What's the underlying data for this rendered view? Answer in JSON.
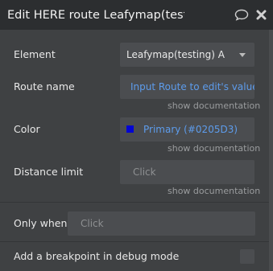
{
  "window": {
    "title": "Edit HERE route Leafymap(testir",
    "icons": {
      "comment": "comment-icon",
      "close": "close-icon"
    }
  },
  "fields": {
    "element": {
      "label": "Element",
      "value": "Leafymap(testing) A"
    },
    "route_name": {
      "label": "Route name",
      "value": "Input Route to edit's value",
      "doc": "show documentation"
    },
    "color": {
      "label": "Color",
      "value": "Primary (#0205D3)",
      "swatch": "#0205D3",
      "doc": "show documentation"
    },
    "distance_limit": {
      "label": "Distance limit",
      "placeholder": "Click",
      "doc": "show documentation"
    },
    "only_when": {
      "label": "Only when",
      "placeholder": "Click"
    },
    "breakpoint": {
      "label": "Add a breakpoint in debug mode",
      "checked": false
    }
  },
  "colors": {
    "accent": "#5D9CEC",
    "background": "#3F4143",
    "header": "#2C2E30"
  }
}
